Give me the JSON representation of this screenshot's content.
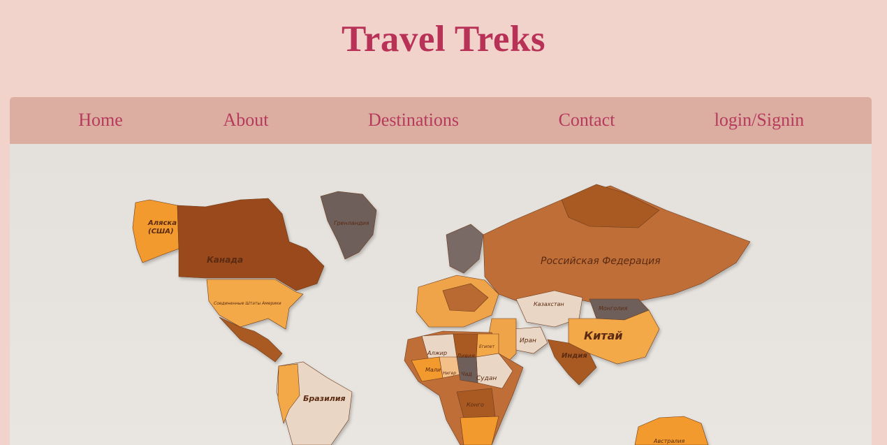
{
  "header": {
    "title": "Travel Treks"
  },
  "nav": {
    "items": [
      {
        "label": "Home"
      },
      {
        "label": "About"
      },
      {
        "label": "Destinations"
      },
      {
        "label": "Contact"
      },
      {
        "label": "login/Signin"
      }
    ]
  },
  "hero": {
    "map_labels": {
      "alaska": "Аляска\n(США)",
      "canada": "Канада",
      "greenland": "Гренландия",
      "usa": "Соединенные Штаты Америки",
      "russia": "Российская Федерация",
      "kazakhstan": "Казахстан",
      "mongolia": "Монголия",
      "china": "Китай",
      "india": "Индия",
      "iran": "Иран",
      "brazil": "Бразилия",
      "algeria": "Алжир",
      "libya": "Ливия",
      "egypt": "Египет",
      "sudan": "Судан",
      "mali": "Мали",
      "niger": "Нигер",
      "chad": "Чад",
      "congo": "Конго",
      "australia": "Австралия"
    }
  }
}
